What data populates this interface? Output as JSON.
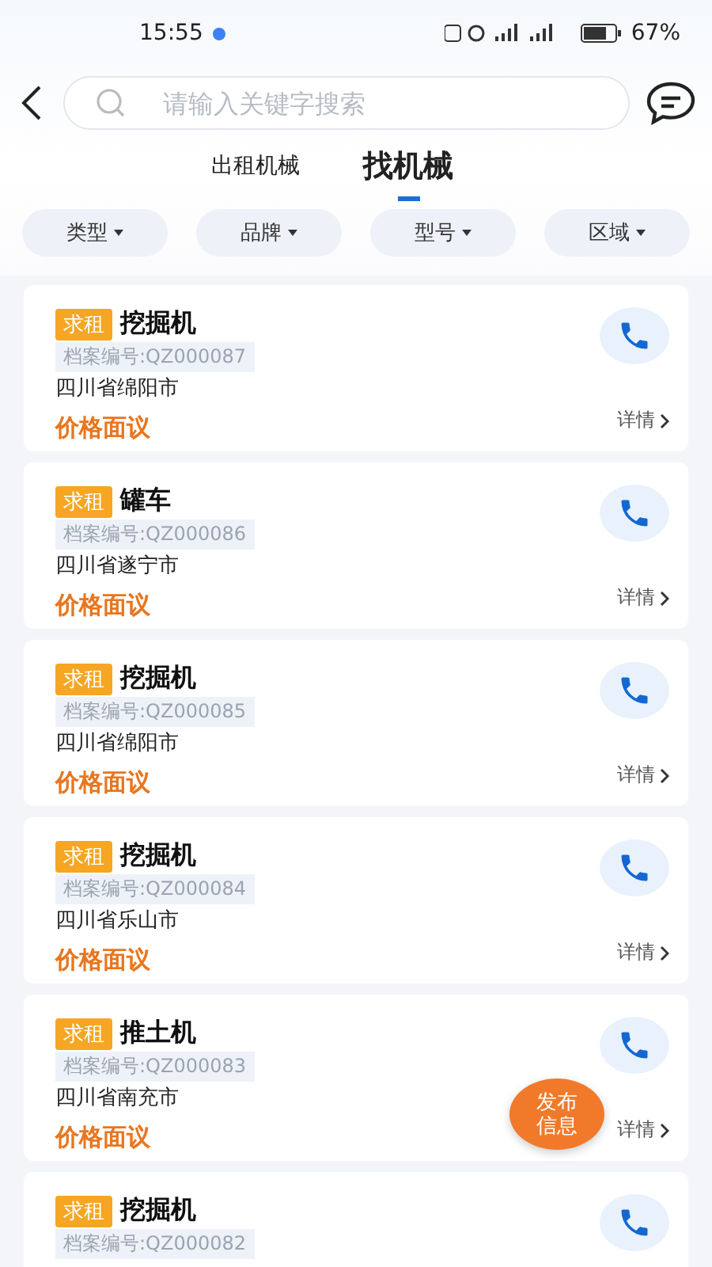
{
  "status_bar": {
    "time": "15:55",
    "battery": "67%"
  },
  "search": {
    "placeholder": "请输入关键字搜索"
  },
  "tabs": [
    {
      "label": "出租机械",
      "selected": false
    },
    {
      "label": "找机械",
      "selected": true
    }
  ],
  "filters": [
    "类型",
    "品牌",
    "型号",
    "区域"
  ],
  "listings": [
    {
      "tag": "求租",
      "title": "挖掘机",
      "code": "档案编号:QZ000087",
      "location": "四川省绵阳市",
      "price": "价格面议",
      "details": "详情"
    },
    {
      "tag": "求租",
      "title": "罐车",
      "code": "档案编号:QZ000086",
      "location": "四川省遂宁市",
      "price": "价格面议",
      "details": "详情"
    },
    {
      "tag": "求租",
      "title": "挖掘机",
      "code": "档案编号:QZ000085",
      "location": "四川省绵阳市",
      "price": "价格面议",
      "details": "详情"
    },
    {
      "tag": "求租",
      "title": "挖掘机",
      "code": "档案编号:QZ000084",
      "location": "四川省乐山市",
      "price": "价格面议",
      "details": "详情"
    },
    {
      "tag": "求租",
      "title": "推土机",
      "code": "档案编号:QZ000083",
      "location": "四川省南充市",
      "price": "价格面议",
      "details": "详情"
    },
    {
      "tag": "求租",
      "title": "挖掘机",
      "code": "档案编号:QZ000082"
    }
  ],
  "fab": {
    "label": "发布信息"
  }
}
